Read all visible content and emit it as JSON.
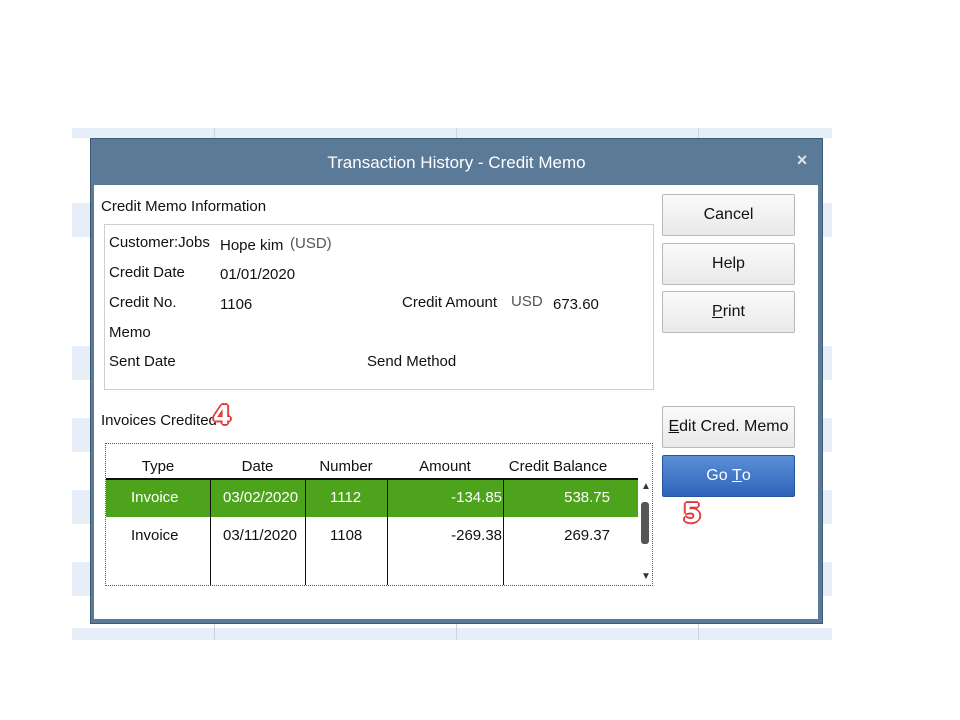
{
  "dialog": {
    "title": "Transaction History - Credit Memo",
    "close_glyph": "×"
  },
  "info": {
    "section_title": "Credit Memo Information",
    "customer_label": "Customer:Jobs",
    "customer_value": "Hope kim",
    "customer_currency": "(USD)",
    "credit_date_label": "Credit Date",
    "credit_date_value": "01/01/2020",
    "credit_no_label": "Credit No.",
    "credit_no_value": "1106",
    "credit_amount_label": "Credit Amount",
    "credit_amount_currency": "USD",
    "credit_amount_value": "673.60",
    "memo_label": "Memo",
    "sent_date_label": "Sent Date",
    "send_method_label": "Send Method"
  },
  "invoices": {
    "section_title": "Invoices Credited",
    "columns": [
      "Type",
      "Date",
      "Number",
      "Amount",
      "Credit Balance"
    ],
    "rows": [
      {
        "type": "Invoice",
        "date": "03/02/2020",
        "number": "1112",
        "amount": "-134.85",
        "balance": "538.75"
      },
      {
        "type": "Invoice",
        "date": "03/11/2020",
        "number": "1108",
        "amount": "-269.38",
        "balance": "269.37"
      }
    ]
  },
  "buttons": {
    "cancel": "Cancel",
    "help": "Help",
    "print_u": "P",
    "print_rest": "rint",
    "edit_u": "E",
    "edit_rest": "dit Cred. Memo",
    "goto_pre": "Go ",
    "goto_u": "T",
    "goto_rest": "o"
  },
  "annotations": {
    "step4": "4",
    "step5": "5"
  },
  "colors": {
    "selected_row": "#4ea31c",
    "primary_button": "#3d72c8",
    "title_bar": "#5b7a98",
    "annotation": "#d33333"
  },
  "icons": {
    "close": "close-icon",
    "scroll_up": "scroll-up-arrow-icon",
    "scroll_down": "scroll-down-arrow-icon"
  }
}
